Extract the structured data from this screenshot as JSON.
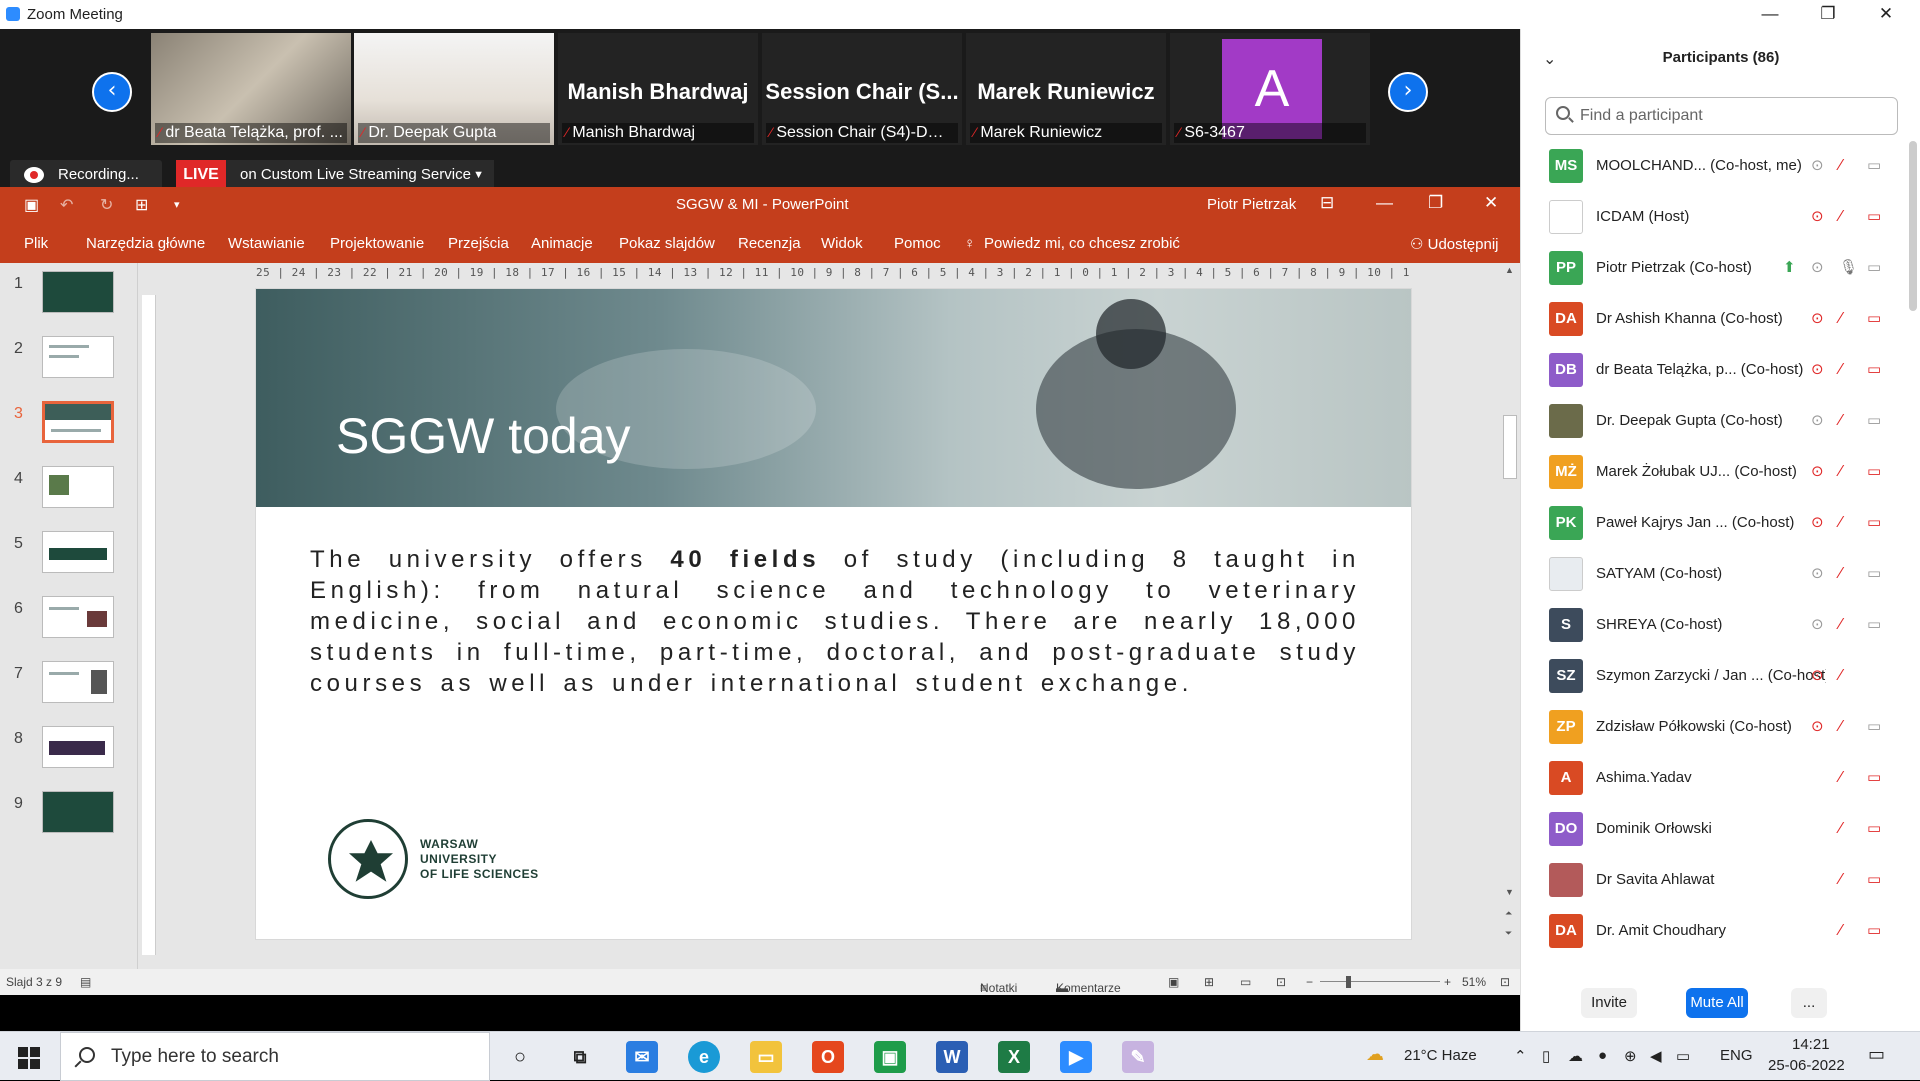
{
  "window": {
    "title": "Zoom Meeting"
  },
  "video_strip": {
    "tiles": [
      {
        "name": "",
        "label": "dr Beata Telążka, prof. ..."
      },
      {
        "name": "",
        "label": "Dr. Deepak Gupta"
      },
      {
        "name": "Manish Bhardwaj",
        "label": "Manish Bhardwaj"
      },
      {
        "name": "Session Chair (S...",
        "label": "Session Chair (S4)-DR...."
      },
      {
        "name": "Marek Runiewicz",
        "label": "Marek Runiewicz"
      },
      {
        "name": "",
        "avatar_letter": "A",
        "label": "S6-3467"
      }
    ]
  },
  "recording": {
    "label": "Recording...",
    "live": "LIVE",
    "stream": "on Custom Live Streaming Service"
  },
  "powerpoint": {
    "title": "SGGW & MI  -  PowerPoint",
    "user": "Piotr Pietrzak",
    "tabs": [
      "Plik",
      "Narzędzia główne",
      "Wstawianie",
      "Projektowanie",
      "Przejścia",
      "Animacje",
      "Pokaz slajdów",
      "Recenzja",
      "Widok",
      "Pomoc"
    ],
    "tell_me": "Powiedz mi, co chcesz zrobić",
    "share": "Udostępnij",
    "ruler": "25 | 24 | 23 | 22 | 21 | 20 | 19 | 18 | 17 | 16 | 15 | 14 | 13 | 12 | 11 | 10 | 9 | 8 | 7 | 6 | 5 | 4 | 3 | 2 | 1 | 0 | 1 | 2 | 3 | 4 | 5 | 6 | 7 | 8 | 9 | 10 | 11 | 12 | 13 | 14 | 15 | 16 | 17 | 18 | 19 | 20 | 21 | 22 | 23 | 24 | 25",
    "thumbnails": [
      "1",
      "2",
      "3",
      "4",
      "5",
      "6",
      "7",
      "8",
      "9"
    ],
    "selected_slide": 3,
    "slide": {
      "title": "SGGW today",
      "body_1": "The university offers ",
      "body_bold": "40 fields",
      "body_2": " of study (including 8 taught in English): from natural science and technology to veterinary medicine, social and economic studies. There are nearly 18,000 students in full-time, part-time, doctoral, and post-graduate study courses as well as under international student exchange.",
      "logo_line1": "WARSAW",
      "logo_line2": "UNIVERSITY",
      "logo_line3": "OF LIFE SCIENCES"
    },
    "status": {
      "slide_info": "Slajd 3 z 9",
      "notes": "Notatki",
      "comments": "Komentarze",
      "zoom": "51%"
    }
  },
  "participants": {
    "title": "Participants (86)",
    "search_placeholder": "Find a participant",
    "list": [
      {
        "initials": "MS",
        "color": "#3aa655",
        "name": "MOOLCHAND... (Co-host, me)"
      },
      {
        "initials": "",
        "color": "#ffffff",
        "name": "ICDAM (Host)"
      },
      {
        "initials": "PP",
        "color": "#3aa655",
        "name": "Piotr Pietrzak (Co-host)"
      },
      {
        "initials": "DA",
        "color": "#d94a23",
        "name": "Dr Ashish Khanna (Co-host)"
      },
      {
        "initials": "DB",
        "color": "#8e5cc9",
        "name": "dr Beata Telążka, p...  (Co-host)"
      },
      {
        "initials": "",
        "color": "#6b6b4a",
        "name": "Dr. Deepak Gupta (Co-host)"
      },
      {
        "initials": "MŻ",
        "color": "#f0a020",
        "name": "Marek Żołubak UJ...  (Co-host)"
      },
      {
        "initials": "PK",
        "color": "#3aa655",
        "name": "Paweł Kajrys Jan ...  (Co-host)"
      },
      {
        "initials": "",
        "color": "#e8ecf0",
        "name": "SATYAM (Co-host)"
      },
      {
        "initials": "S",
        "color": "#3d4b5c",
        "name": "SHREYA (Co-host)"
      },
      {
        "initials": "SZ",
        "color": "#3d4b5c",
        "name": "Szymon Zarzycki / Jan ...  (Co-host)"
      },
      {
        "initials": "ZP",
        "color": "#f0a020",
        "name": "Zdzisław Półkowski (Co-host)"
      },
      {
        "initials": "A",
        "color": "#d94a23",
        "name": "Ashima.Yadav"
      },
      {
        "initials": "DO",
        "color": "#8e5cc9",
        "name": "Dominik Orłowski"
      },
      {
        "initials": "",
        "color": "#b35a5a",
        "name": "Dr Savita Ahlawat"
      },
      {
        "initials": "DA",
        "color": "#d94a23",
        "name": "Dr. Amit Choudhary"
      }
    ],
    "invite": "Invite",
    "mute_all": "Mute All",
    "more": "..."
  },
  "taskbar": {
    "search_placeholder": "Type here to search",
    "weather": "21°C  Haze",
    "lang": "ENG",
    "time": "14:21",
    "date": "25-06-2022"
  },
  "colors": {
    "ppt_accent": "#c43e1c",
    "zoom_blue": "#0e72ed",
    "live_red": "#e02828"
  }
}
